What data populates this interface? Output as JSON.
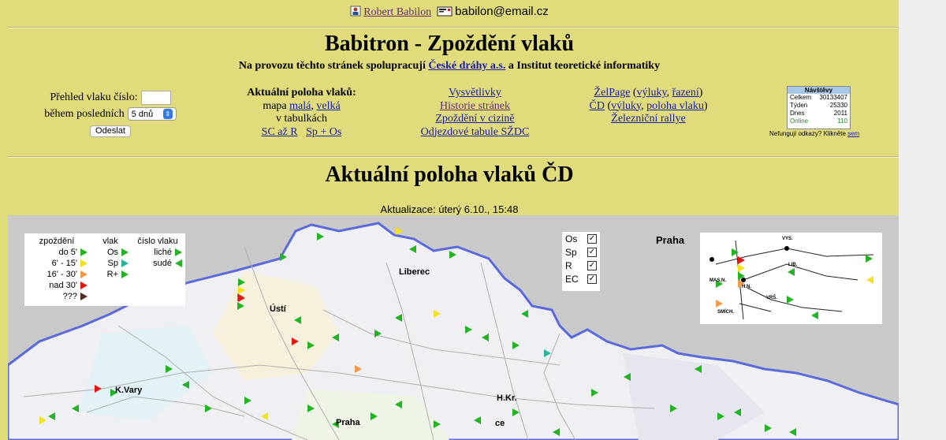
{
  "header": {
    "author_name": "Robert Babilon",
    "email": "babilon@email.cz",
    "title": "Babitron - Zpoždění vlaků",
    "subtitle_prefix": "Na provozu těchto stránek spolupracují",
    "partner_link": "České dráhy a.s.",
    "subtitle_suffix": "a Institut teoretické informatiky"
  },
  "form": {
    "train_label": "Přehled vlaku číslo:",
    "period_label": "během posledních",
    "period_value": "5 dnů",
    "submit": "Odeslat"
  },
  "positions": {
    "heading": "Aktuální poloha vlaků:",
    "map_prefix": "mapa",
    "map_small": "malá",
    "map_large": "velká",
    "tables_label": "v tabulkách",
    "tables_sc_r": "SC až R",
    "tables_sp_os": "Sp + Os"
  },
  "links_mid": [
    "Vysvětlivky",
    "Historie stránek",
    "Zpoždění v cizině",
    "Odjezdové tabule SŽDC"
  ],
  "links_right": {
    "zelpage": "ŽelPage",
    "vyluky": "výluky",
    "razeni": "řazení",
    "cd": "ČD",
    "vyluky2": "výluky",
    "poloha": "poloha vlaku",
    "rallye": "Železniční rallye"
  },
  "counter": {
    "title": "Návštěvy",
    "rows": [
      {
        "label": "Celkem",
        "value": "30133407"
      },
      {
        "label": "Týden",
        "value": "25330"
      },
      {
        "label": "Dnes",
        "value": "2011"
      },
      {
        "label": "Online",
        "value": "110"
      }
    ],
    "broken_text": "Nefungují odkazy? Klikněte",
    "broken_link": "sem"
  },
  "main": {
    "heading": "Aktuální poloha vlaků ČD",
    "updated": "Aktualizace: úterý 6.10., 15:48"
  },
  "legend": {
    "delay_header": "zpoždění",
    "delays": [
      "do 5'",
      "6' - 15'",
      "16' - 30'",
      "nad 30'",
      "???"
    ],
    "delay_colors": [
      "#22b422",
      "#f2e21c",
      "#f59a4a",
      "#e01818",
      "#5a2a1a"
    ],
    "train_header": "vlak",
    "trains": [
      "Os",
      "Sp",
      "R+"
    ],
    "train_colors": [
      "#22b422",
      "#22b4a0",
      "#22b422"
    ],
    "number_header": "číslo vlaku",
    "numbers": [
      "liché",
      "sudé"
    ]
  },
  "filter": [
    {
      "label": "Os",
      "checked": true
    },
    {
      "label": "Sp",
      "checked": true
    },
    {
      "label": "R",
      "checked": true
    },
    {
      "label": "EC",
      "checked": true
    }
  ],
  "map": {
    "praha_label": "Praha",
    "cities": [
      "Liberec",
      "Ústí",
      "K.Vary",
      "H.Kr.",
      "Praha",
      "ce"
    ],
    "inset_labels": [
      "VYS.",
      "LIB.",
      "MAS.N.",
      "H.N.",
      "VRŠ.",
      "SMÍCH."
    ]
  }
}
